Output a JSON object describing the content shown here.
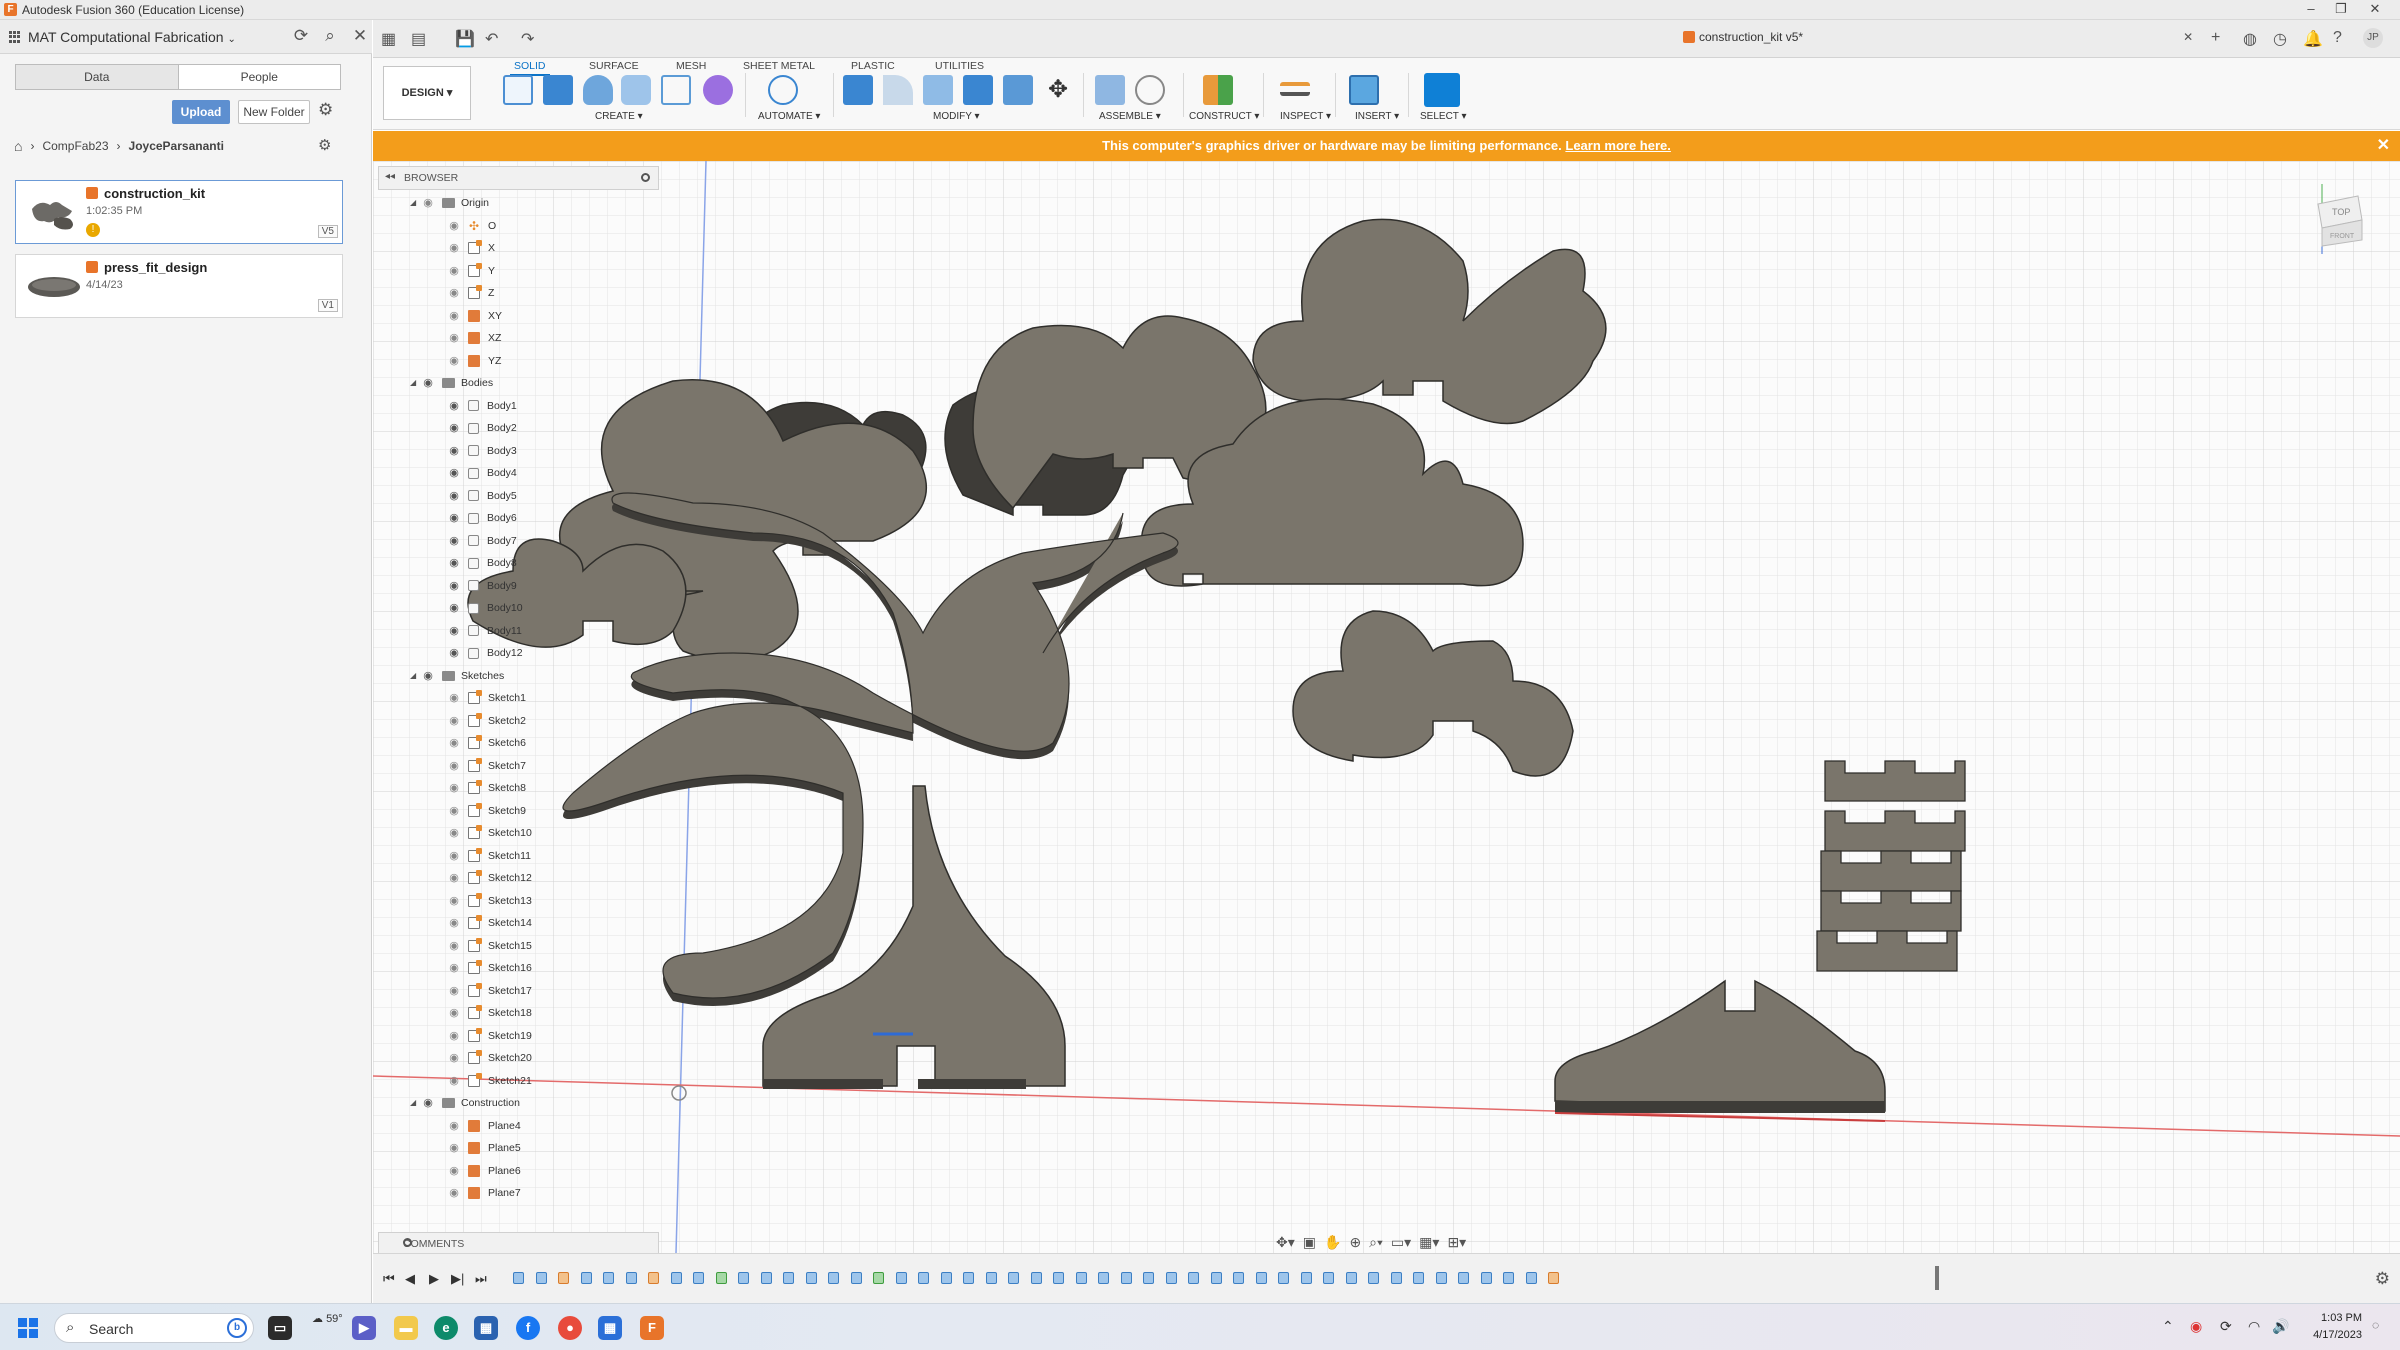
{
  "window": {
    "title": "Autodesk Fusion 360 (Education License)"
  },
  "data_panel": {
    "project_name": "MAT Computational Fabrication",
    "tabs": [
      "Data",
      "People"
    ],
    "upload_label": "Upload",
    "new_folder_label": "New Folder",
    "breadcrumb": [
      "CompFab23",
      "JoyceParsananti"
    ],
    "files": [
      {
        "name": "construction_kit",
        "time": "1:02:35 PM",
        "version": "V5"
      },
      {
        "name": "press_fit_design",
        "time": "4/14/23",
        "version": "V1"
      }
    ]
  },
  "document": {
    "tab_title": "construction_kit v5*"
  },
  "toolbar": {
    "workspace": "DESIGN",
    "workspace_tabs": [
      "SOLID",
      "SURFACE",
      "MESH",
      "SHEET METAL",
      "PLASTIC",
      "UTILITIES"
    ],
    "active_tab": "SOLID",
    "groups": [
      "CREATE",
      "AUTOMATE",
      "MODIFY",
      "ASSEMBLE",
      "CONSTRUCT",
      "INSPECT",
      "INSERT",
      "SELECT"
    ]
  },
  "banner": {
    "text": "This computer's graphics driver or hardware may be limiting performance.",
    "link": "Learn more here."
  },
  "browser": {
    "title": "BROWSER",
    "origin": {
      "label": "Origin",
      "items": [
        "O",
        "X",
        "Y",
        "Z",
        "XY",
        "XZ",
        "YZ"
      ]
    },
    "bodies": {
      "label": "Bodies",
      "items": [
        "Body1",
        "Body2",
        "Body3",
        "Body4",
        "Body5",
        "Body6",
        "Body7",
        "Body8",
        "Body9",
        "Body10",
        "Body11",
        "Body12"
      ]
    },
    "sketches": {
      "label": "Sketches",
      "items": [
        "Sketch1",
        "Sketch2",
        "Sketch6",
        "Sketch7",
        "Sketch8",
        "Sketch9",
        "Sketch10",
        "Sketch11",
        "Sketch12",
        "Sketch13",
        "Sketch14",
        "Sketch15",
        "Sketch16",
        "Sketch17",
        "Sketch18",
        "Sketch19",
        "Sketch20",
        "Sketch21"
      ]
    },
    "construction": {
      "label": "Construction",
      "items": [
        "Plane4",
        "Plane5",
        "Plane6",
        "Plane7"
      ]
    }
  },
  "comments": {
    "label": "COMMENTS"
  },
  "viewcube": {
    "top": "TOP",
    "front": "FRONT"
  },
  "taskbar": {
    "search": "Search",
    "temp": "59°",
    "time": "1:03 PM",
    "date": "4/17/2023"
  },
  "colors": {
    "accent": "#0b73c7",
    "banner": "#f39d1b",
    "body_top": "#7a756b",
    "body_side": "#3e3c38"
  }
}
